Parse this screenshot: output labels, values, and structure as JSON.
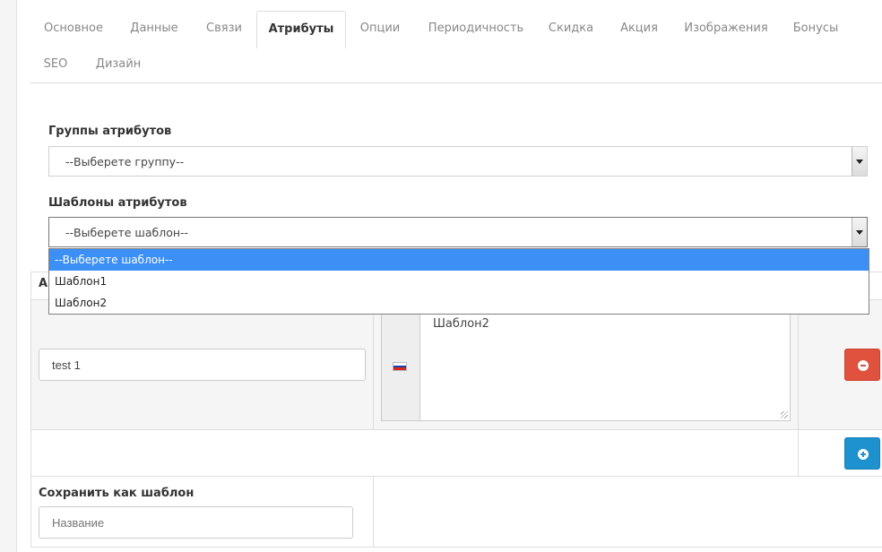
{
  "tabs": [
    {
      "label": "Основное"
    },
    {
      "label": "Данные"
    },
    {
      "label": "Связи"
    },
    {
      "label": "Атрибуты",
      "active": true
    },
    {
      "label": "Опции"
    },
    {
      "label": "Периодичность"
    },
    {
      "label": "Скидка"
    },
    {
      "label": "Акция"
    },
    {
      "label": "Изображения"
    },
    {
      "label": "Бонусы"
    },
    {
      "label": "SEO"
    },
    {
      "label": "Дизайн"
    }
  ],
  "attribute_groups": {
    "label": "Группы атрибутов",
    "selected": "--Выберете группу--"
  },
  "attribute_templates": {
    "label": "Шаблоны атрибутов",
    "selected": "--Выберете шаблон--",
    "options": [
      "--Выберете шаблон--",
      "Шаблон1",
      "Шаблон2"
    ]
  },
  "table": {
    "header_partial": "А",
    "row": {
      "name_value": "test 1",
      "language_flag": "ru-flag-icon",
      "text_value": "Шаблон2"
    }
  },
  "save_template": {
    "label": "Сохранить как шаблон",
    "placeholder": "Название"
  },
  "colors": {
    "accent_blue": "#1e91cf",
    "danger_red": "#e0513e",
    "dropdown_highlight": "#3b8ff5"
  }
}
